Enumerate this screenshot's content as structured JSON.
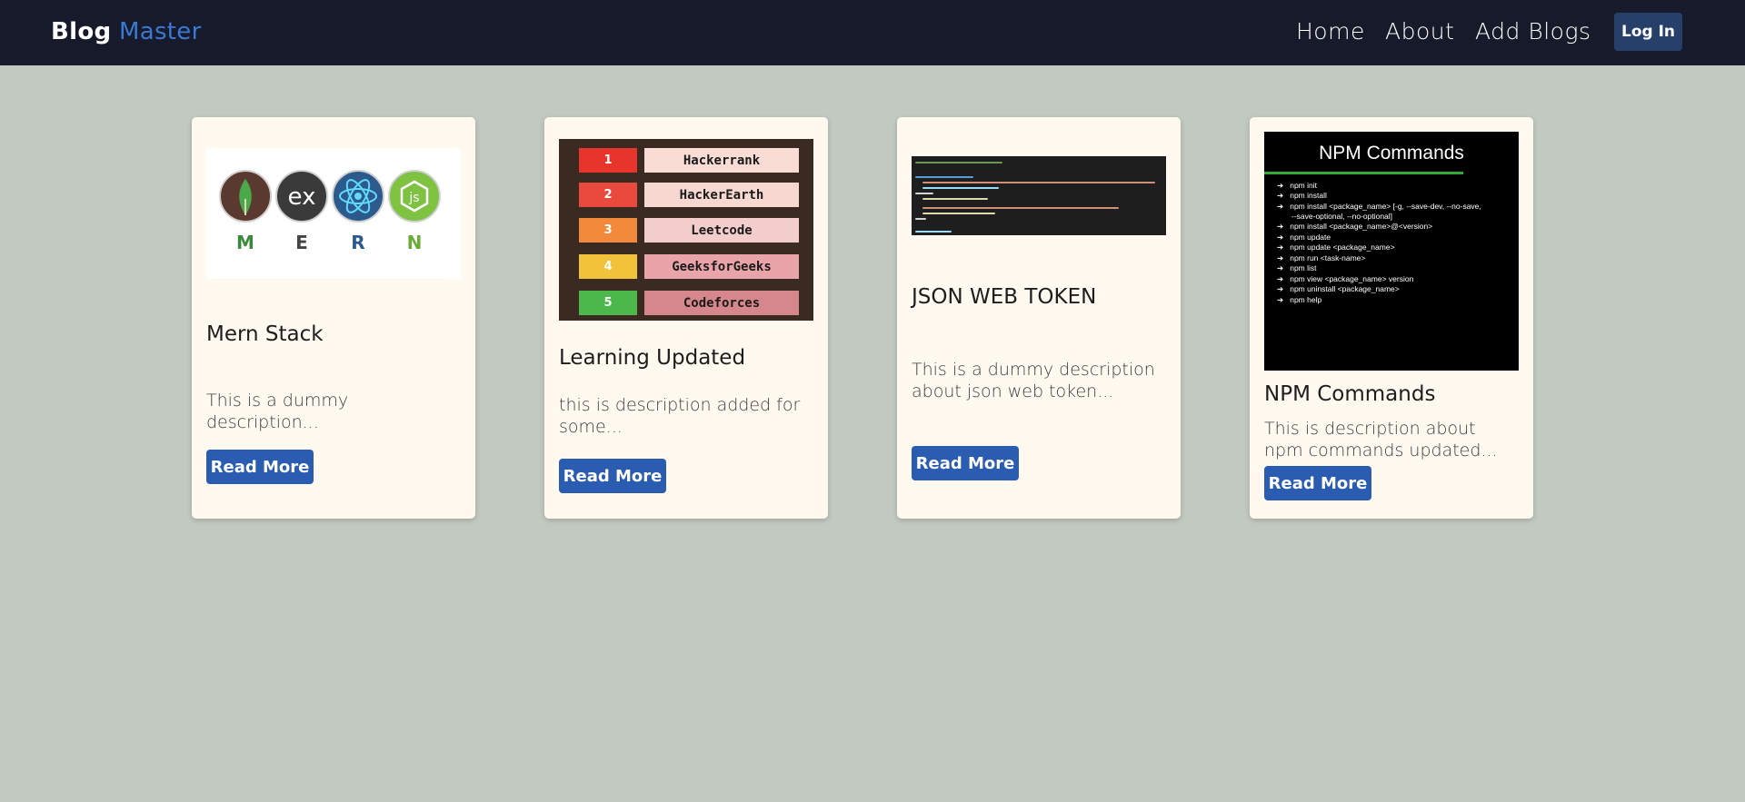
{
  "brand": {
    "part1": "Blog",
    "part2": "Master",
    "accent": "#3b79d4"
  },
  "nav": {
    "home": "Home",
    "about": "About",
    "add_blogs": "Add Blogs",
    "login": "Log In"
  },
  "cards": [
    {
      "title": "Mern Stack",
      "description": "This is a dummy description...",
      "button": "Read More",
      "image": {
        "logos": [
          "mongodb-leaf-icon",
          "express-icon",
          "react-icon",
          "nodejs-icon"
        ],
        "ex_text": "ex",
        "js_text": "js",
        "letters": [
          "M",
          "E",
          "R",
          "N"
        ]
      }
    },
    {
      "title": "Learning Updated",
      "description": "this is description added for some...",
      "button": "Read More",
      "image": {
        "ranks": [
          {
            "num": "1",
            "name": "Hackerrank"
          },
          {
            "num": "2",
            "name": "HackerEarth"
          },
          {
            "num": "3",
            "name": "Leetcode"
          },
          {
            "num": "4",
            "name": "GeeksforGeeks"
          },
          {
            "num": "5",
            "name": "Codeforces"
          }
        ]
      }
    },
    {
      "title": "JSON WEB TOKEN",
      "description": "This is a dummy description about json web token...",
      "button": "Read More",
      "image": {
        "kind": "code-screenshot"
      }
    },
    {
      "title": "NPM Commands",
      "description": "This is description about npm commands updated...",
      "button": "Read More",
      "image": {
        "heading": "NPM Commands",
        "items": [
          "npm init",
          "npm install",
          "npm install <package_name> [-g, --save-dev, --no-save,",
          "--save-optional, --no-optional]",
          "npm install <package_name>@<version>",
          "npm update",
          "npm update <package_name>",
          "npm run <task-name>",
          "npm list",
          "npm view <package_name> version",
          "npm uninstall <package_name>",
          "npm help"
        ]
      }
    }
  ]
}
